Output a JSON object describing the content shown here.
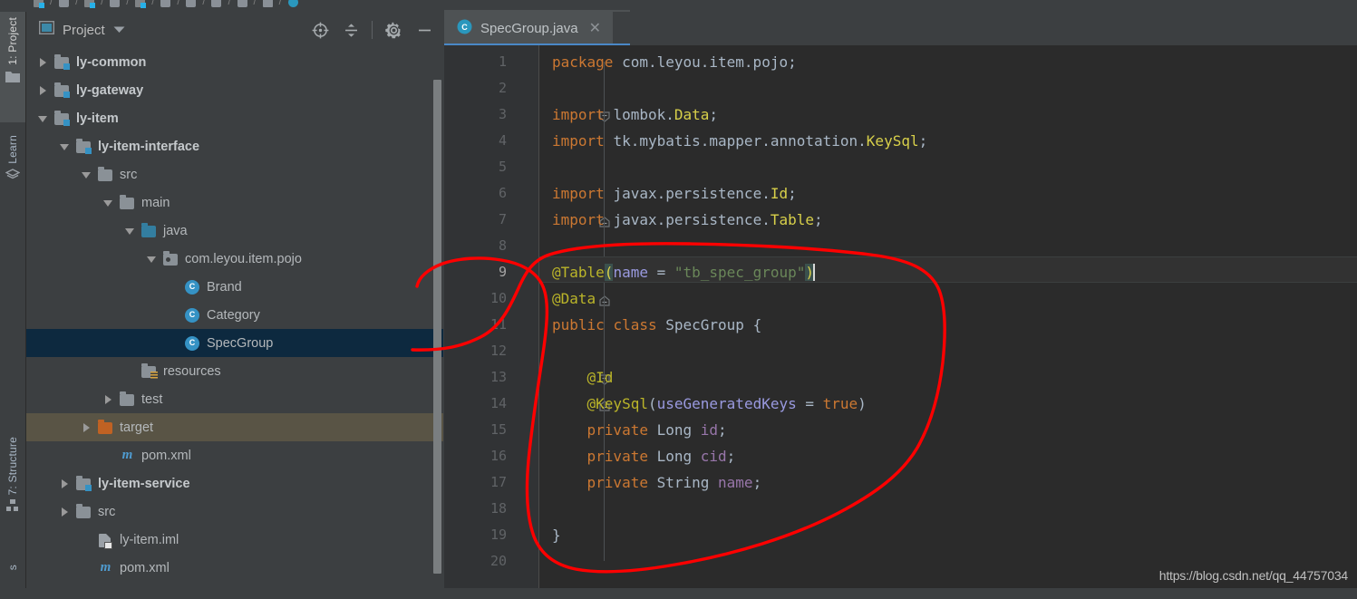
{
  "navbar": {
    "crumbs": [
      {
        "icon": "module-icon",
        "label": ""
      },
      {
        "icon": "folder-icon",
        "label": ""
      },
      {
        "icon": "module-icon",
        "label": ""
      },
      {
        "icon": "folder-icon",
        "label": ""
      },
      {
        "icon": "module-icon",
        "label": ""
      },
      {
        "icon": "folder-icon",
        "label": ""
      },
      {
        "icon": "folder-icon",
        "label": ""
      },
      {
        "icon": "folder-icon",
        "label": ""
      },
      {
        "icon": "folder-icon",
        "label": ""
      },
      {
        "icon": "package-icon",
        "label": ""
      },
      {
        "icon": "class-icon",
        "label": ""
      }
    ],
    "separator": "/"
  },
  "leftbar": {
    "items": [
      {
        "label": "1: Project",
        "icon": "folder-icon",
        "active": true
      },
      {
        "label": "Learn",
        "icon": "books-icon",
        "active": false
      },
      {
        "label": "7: Structure",
        "icon": "structure-icon",
        "active": false
      }
    ]
  },
  "project_panel": {
    "title": "Project",
    "title_icon": "window-icon",
    "dropdown_icon": "chevron-down-icon",
    "actions": [
      {
        "name": "locate-file-icon",
        "tooltip": "Select Opened File"
      },
      {
        "name": "collapse-all-icon",
        "tooltip": "Collapse All"
      },
      {
        "name": "gear-icon",
        "tooltip": "Settings"
      },
      {
        "name": "minimize-icon",
        "tooltip": "Hide"
      }
    ],
    "tree": [
      {
        "label": "ly-common",
        "indent": 0,
        "arrow": "closed",
        "icon": "module-icon",
        "bold": true,
        "state": "normal"
      },
      {
        "label": "ly-gateway",
        "indent": 0,
        "arrow": "closed",
        "icon": "module-icon",
        "bold": true,
        "state": "normal"
      },
      {
        "label": "ly-item",
        "indent": 0,
        "arrow": "open",
        "icon": "module-icon",
        "bold": true,
        "state": "normal"
      },
      {
        "label": "ly-item-interface",
        "indent": 1,
        "arrow": "open",
        "icon": "module-icon",
        "bold": true,
        "state": "normal"
      },
      {
        "label": "src",
        "indent": 2,
        "arrow": "open",
        "icon": "folder-icon",
        "bold": false,
        "state": "normal"
      },
      {
        "label": "main",
        "indent": 3,
        "arrow": "open",
        "icon": "folder-icon",
        "bold": false,
        "state": "normal"
      },
      {
        "label": "java",
        "indent": 4,
        "arrow": "open",
        "icon": "source-root-icon",
        "bold": false,
        "state": "normal"
      },
      {
        "label": "com.leyou.item.pojo",
        "indent": 5,
        "arrow": "open",
        "icon": "package-icon",
        "bold": false,
        "state": "normal"
      },
      {
        "label": "Brand",
        "indent": 6,
        "arrow": "none",
        "icon": "class-icon",
        "bold": false,
        "state": "normal"
      },
      {
        "label": "Category",
        "indent": 6,
        "arrow": "none",
        "icon": "class-icon",
        "bold": false,
        "state": "normal"
      },
      {
        "label": "SpecGroup",
        "indent": 6,
        "arrow": "none",
        "icon": "class-icon",
        "bold": false,
        "state": "selected"
      },
      {
        "label": "resources",
        "indent": 4,
        "arrow": "none",
        "icon": "resources-icon",
        "bold": false,
        "state": "normal"
      },
      {
        "label": "test",
        "indent": 3,
        "arrow": "closed",
        "icon": "folder-icon",
        "bold": false,
        "state": "normal"
      },
      {
        "label": "target",
        "indent": 2,
        "arrow": "closed",
        "icon": "target-folder-icon",
        "bold": false,
        "state": "highlight"
      },
      {
        "label": "pom.xml",
        "indent": 3,
        "arrow": "none",
        "icon": "maven-icon",
        "bold": false,
        "state": "normal"
      },
      {
        "label": "ly-item-service",
        "indent": 1,
        "arrow": "closed",
        "icon": "module-icon",
        "bold": true,
        "state": "normal"
      },
      {
        "label": "src",
        "indent": 1,
        "arrow": "closed",
        "icon": "folder-icon",
        "bold": false,
        "state": "normal"
      },
      {
        "label": "ly-item.iml",
        "indent": 2,
        "arrow": "none",
        "icon": "iml-file-icon",
        "bold": false,
        "state": "normal"
      },
      {
        "label": "pom.xml",
        "indent": 2,
        "arrow": "none",
        "icon": "maven-icon",
        "bold": false,
        "state": "normal"
      }
    ]
  },
  "editor": {
    "tab": {
      "label": "SpecGroup.java",
      "icon": "class-icon",
      "close_icon": "close-icon"
    },
    "current_line": 9,
    "caret_line": 9,
    "line_numbers": [
      1,
      2,
      3,
      4,
      5,
      6,
      7,
      8,
      9,
      10,
      11,
      12,
      13,
      14,
      15,
      16,
      17,
      18,
      19,
      20
    ],
    "code": [
      {
        "n": 1,
        "tokens": [
          {
            "t": "package ",
            "c": "kw"
          },
          {
            "t": "com.leyou.item.pojo;",
            "c": "par"
          }
        ]
      },
      {
        "n": 2,
        "tokens": []
      },
      {
        "n": 3,
        "tokens": [
          {
            "t": "import ",
            "c": "kw"
          },
          {
            "t": "lombok.",
            "c": "par"
          },
          {
            "t": "Data",
            "c": "cls"
          },
          {
            "t": ";",
            "c": "par"
          }
        ]
      },
      {
        "n": 4,
        "tokens": [
          {
            "t": "import ",
            "c": "kw"
          },
          {
            "t": "tk.mybatis.mapper.annotation.",
            "c": "par"
          },
          {
            "t": "KeySql",
            "c": "cls"
          },
          {
            "t": ";",
            "c": "par"
          }
        ]
      },
      {
        "n": 5,
        "tokens": []
      },
      {
        "n": 6,
        "tokens": [
          {
            "t": "import ",
            "c": "kw"
          },
          {
            "t": "javax.persistence.",
            "c": "par"
          },
          {
            "t": "Id",
            "c": "cls"
          },
          {
            "t": ";",
            "c": "par"
          }
        ]
      },
      {
        "n": 7,
        "tokens": [
          {
            "t": "import ",
            "c": "kw"
          },
          {
            "t": "javax.persistence.",
            "c": "par"
          },
          {
            "t": "Table",
            "c": "cls"
          },
          {
            "t": ";",
            "c": "par"
          }
        ]
      },
      {
        "n": 8,
        "tokens": []
      },
      {
        "n": 9,
        "tokens": [
          {
            "t": "@Table",
            "c": "ann"
          },
          {
            "t": "(",
            "c": "bmatch"
          },
          {
            "t": "name",
            "c": "attr"
          },
          {
            "t": " = ",
            "c": "par"
          },
          {
            "t": "\"tb_spec_group\"",
            "c": "str"
          },
          {
            "t": ")",
            "c": "bmatch"
          },
          {
            "t": "",
            "c": "caret"
          }
        ]
      },
      {
        "n": 10,
        "tokens": [
          {
            "t": "@Data",
            "c": "ann"
          }
        ]
      },
      {
        "n": 11,
        "tokens": [
          {
            "t": "public ",
            "c": "kw"
          },
          {
            "t": "class ",
            "c": "kw"
          },
          {
            "t": "SpecGroup",
            "c": "par"
          },
          {
            "t": " {",
            "c": "brace"
          }
        ]
      },
      {
        "n": 12,
        "tokens": []
      },
      {
        "n": 13,
        "tokens": [
          {
            "t": "    @Id",
            "c": "ann"
          }
        ]
      },
      {
        "n": 14,
        "tokens": [
          {
            "t": "    @KeySql",
            "c": "ann"
          },
          {
            "t": "(",
            "c": "par"
          },
          {
            "t": "useGeneratedKeys",
            "c": "attr"
          },
          {
            "t": " = ",
            "c": "par"
          },
          {
            "t": "true",
            "c": "kw"
          },
          {
            "t": ")",
            "c": "par"
          }
        ]
      },
      {
        "n": 15,
        "tokens": [
          {
            "t": "    private ",
            "c": "kw"
          },
          {
            "t": "Long ",
            "c": "par"
          },
          {
            "t": "id",
            "c": "fld"
          },
          {
            "t": ";",
            "c": "par"
          }
        ]
      },
      {
        "n": 16,
        "tokens": [
          {
            "t": "    private ",
            "c": "kw"
          },
          {
            "t": "Long ",
            "c": "par"
          },
          {
            "t": "cid",
            "c": "fld"
          },
          {
            "t": ";",
            "c": "par"
          }
        ]
      },
      {
        "n": 17,
        "tokens": [
          {
            "t": "    private ",
            "c": "kw"
          },
          {
            "t": "String ",
            "c": "par"
          },
          {
            "t": "name",
            "c": "fld"
          },
          {
            "t": ";",
            "c": "par"
          }
        ]
      },
      {
        "n": 18,
        "tokens": []
      },
      {
        "n": 19,
        "tokens": [
          {
            "t": "}",
            "c": "brace"
          }
        ]
      },
      {
        "n": 20,
        "tokens": []
      }
    ],
    "fold_markers": [
      {
        "line": 3,
        "type": "start"
      },
      {
        "line": 7,
        "type": "end"
      },
      {
        "line": 9,
        "type": "start"
      },
      {
        "line": 10,
        "type": "end"
      },
      {
        "line": 13,
        "type": "start"
      },
      {
        "line": 14,
        "type": "end"
      }
    ]
  },
  "watermark": "https://blog.csdn.net/qq_44757034",
  "annotation": {
    "color": "#ff0000",
    "shape": "hand-drawn-loop-around-class-body"
  },
  "colors": {
    "editor_bg": "#2b2b2b",
    "panel_bg": "#3c3f41",
    "gutter_bg": "#313335",
    "selection_blue": "#0d293f",
    "highlight_olive": "#595445",
    "tab_active": "#4e5254",
    "tab_underline": "#4a88c7",
    "keyword": "#cc7832",
    "class_name": "#d8d04a",
    "annotation_token": "#bbb529",
    "string": "#6a8759",
    "field": "#9876aa",
    "attribute": "#9a9ae0",
    "default_text": "#a9b7c6",
    "line_number": "#606366",
    "module_badge": "#3592c4",
    "target_folder": "#c06223"
  }
}
